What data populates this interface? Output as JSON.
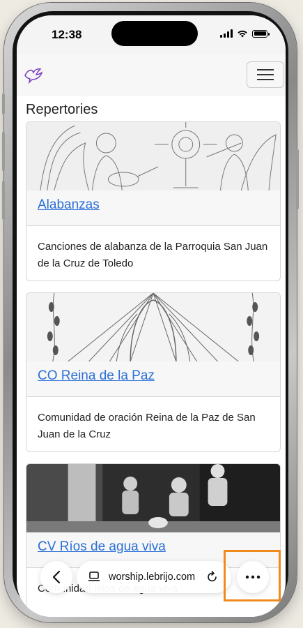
{
  "status_bar": {
    "time": "12:38"
  },
  "navbar": {
    "logo_icon": "dove-icon",
    "menu_icon": "hamburger-icon"
  },
  "page": {
    "title": "Repertories"
  },
  "cards": [
    {
      "link": "Alabanzas",
      "description": "Canciones de alabanza de la Parroquia San Juan de la Cruz de Toledo"
    },
    {
      "link": "CO Reina de la Paz",
      "description": "Comunidad de oración Reina de la Paz de San Juan de la Cruz"
    },
    {
      "link": "CV Ríos de agua viva",
      "description": "Comunidad Ríos de agua viva"
    }
  ],
  "browser_bar": {
    "url": "worship.lebrijo.com",
    "back_icon": "chevron-left-icon",
    "more_icon": "more-dots-icon"
  },
  "colors": {
    "link": "#2b6fd6",
    "highlight": "#f08a1c",
    "logo": "#7b3fbf"
  }
}
